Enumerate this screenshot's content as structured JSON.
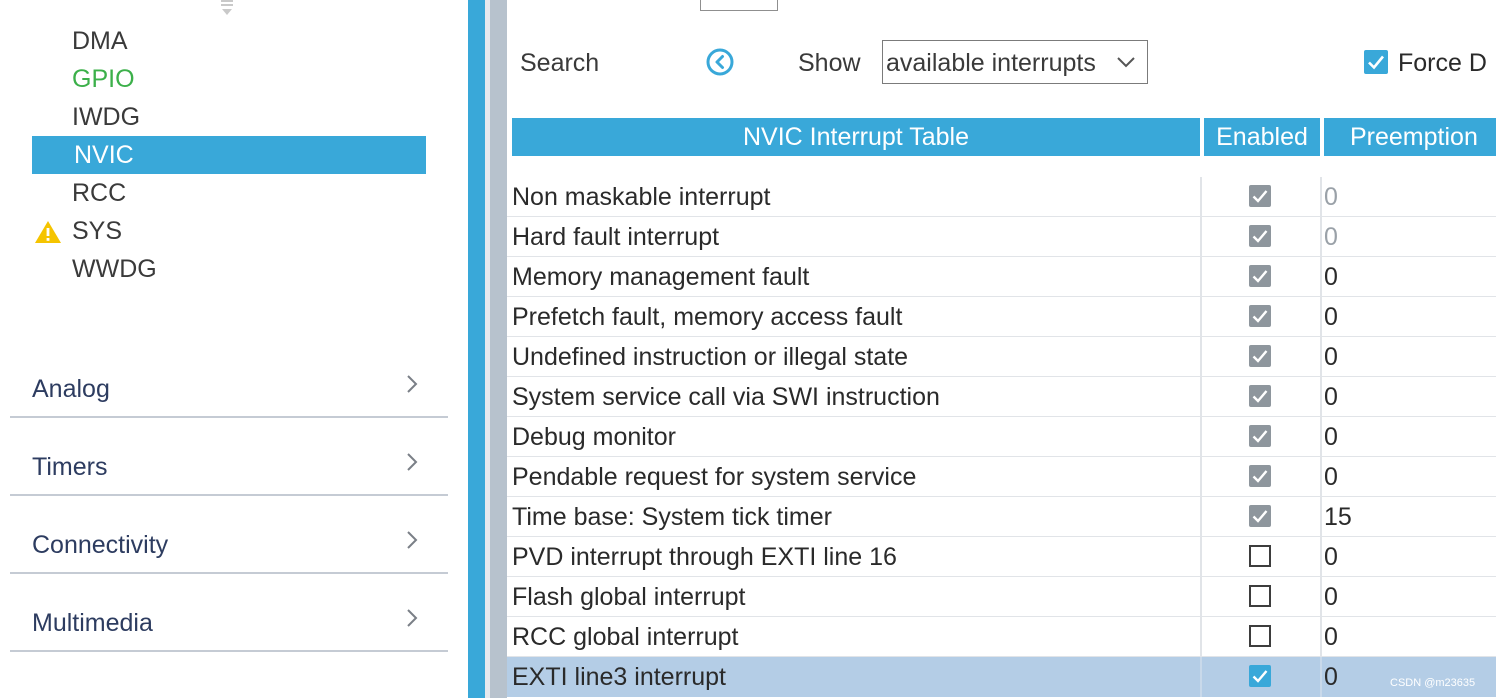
{
  "sidebar": {
    "system_items": [
      {
        "label": "DMA",
        "state": "normal"
      },
      {
        "label": "GPIO",
        "state": "configured"
      },
      {
        "label": "IWDG",
        "state": "normal"
      },
      {
        "label": "NVIC",
        "state": "selected"
      },
      {
        "label": "RCC",
        "state": "normal"
      },
      {
        "label": "SYS",
        "state": "warning"
      },
      {
        "label": "WWDG",
        "state": "normal"
      }
    ],
    "categories": [
      {
        "label": "Analog"
      },
      {
        "label": "Timers"
      },
      {
        "label": "Connectivity"
      },
      {
        "label": "Multimedia"
      }
    ]
  },
  "toolbar": {
    "search_label": "Search",
    "show_label": "Show",
    "show_value": "available interrupts",
    "force_label": "Force D",
    "force_checked": true
  },
  "table": {
    "headers": {
      "name": "NVIC Interrupt Table",
      "enabled": "Enabled",
      "preemption": "Preemption"
    },
    "rows": [
      {
        "name": "Non maskable interrupt",
        "enabled": true,
        "locked": true,
        "preemption": "0",
        "muted": true
      },
      {
        "name": "Hard fault interrupt",
        "enabled": true,
        "locked": true,
        "preemption": "0",
        "muted": true
      },
      {
        "name": "Memory management fault",
        "enabled": true,
        "locked": true,
        "preemption": "0"
      },
      {
        "name": "Prefetch fault, memory access fault",
        "enabled": true,
        "locked": true,
        "preemption": "0"
      },
      {
        "name": "Undefined instruction or illegal state",
        "enabled": true,
        "locked": true,
        "preemption": "0"
      },
      {
        "name": "System service call via SWI instruction",
        "enabled": true,
        "locked": true,
        "preemption": "0"
      },
      {
        "name": "Debug monitor",
        "enabled": true,
        "locked": true,
        "preemption": "0"
      },
      {
        "name": "Pendable request for system service",
        "enabled": true,
        "locked": true,
        "preemption": "0"
      },
      {
        "name": "Time base: System tick timer",
        "enabled": true,
        "locked": true,
        "preemption": "15"
      },
      {
        "name": "PVD interrupt through EXTI line 16",
        "enabled": false,
        "locked": false,
        "preemption": "0"
      },
      {
        "name": "Flash global interrupt",
        "enabled": false,
        "locked": false,
        "preemption": "0"
      },
      {
        "name": "RCC global interrupt",
        "enabled": false,
        "locked": false,
        "preemption": "0"
      },
      {
        "name": "EXTI line3 interrupt",
        "enabled": true,
        "locked": false,
        "preemption": "0",
        "highlight": true
      }
    ]
  },
  "watermark": "CSDN @m23635",
  "colors": {
    "accent": "#39a8d9",
    "configured": "#3cb04a",
    "warning": "#f5c400",
    "row_highlight": "#b4cde6"
  }
}
